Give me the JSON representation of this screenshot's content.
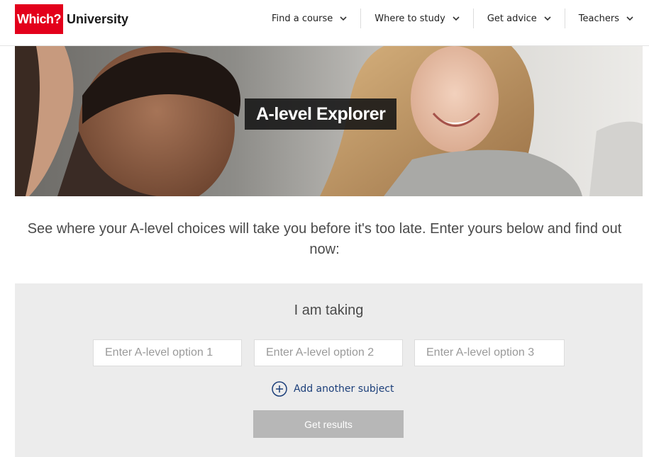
{
  "header": {
    "logo_which": "Which?",
    "logo_university": "University",
    "nav": [
      {
        "label": "Find a course"
      },
      {
        "label": "Where to study"
      },
      {
        "label": "Get advice"
      },
      {
        "label": "Teachers"
      }
    ]
  },
  "hero": {
    "title": "A-level Explorer"
  },
  "intro": {
    "text": "See where your A-level choices will take you before it's too late. Enter yours below and find out now:"
  },
  "form": {
    "heading": "I am taking",
    "inputs": [
      {
        "placeholder": "Enter A-level option 1",
        "value": ""
      },
      {
        "placeholder": "Enter A-level option 2",
        "value": ""
      },
      {
        "placeholder": "Enter A-level option 3",
        "value": ""
      }
    ],
    "add_label": "Add another subject",
    "add_icon": "plus-circle-icon",
    "submit_label": "Get results"
  },
  "colors": {
    "brand_red": "#e3001b",
    "link_blue": "#1c3f7a",
    "panel_bg": "#ececec",
    "button_disabled": "#b7b7b7"
  }
}
